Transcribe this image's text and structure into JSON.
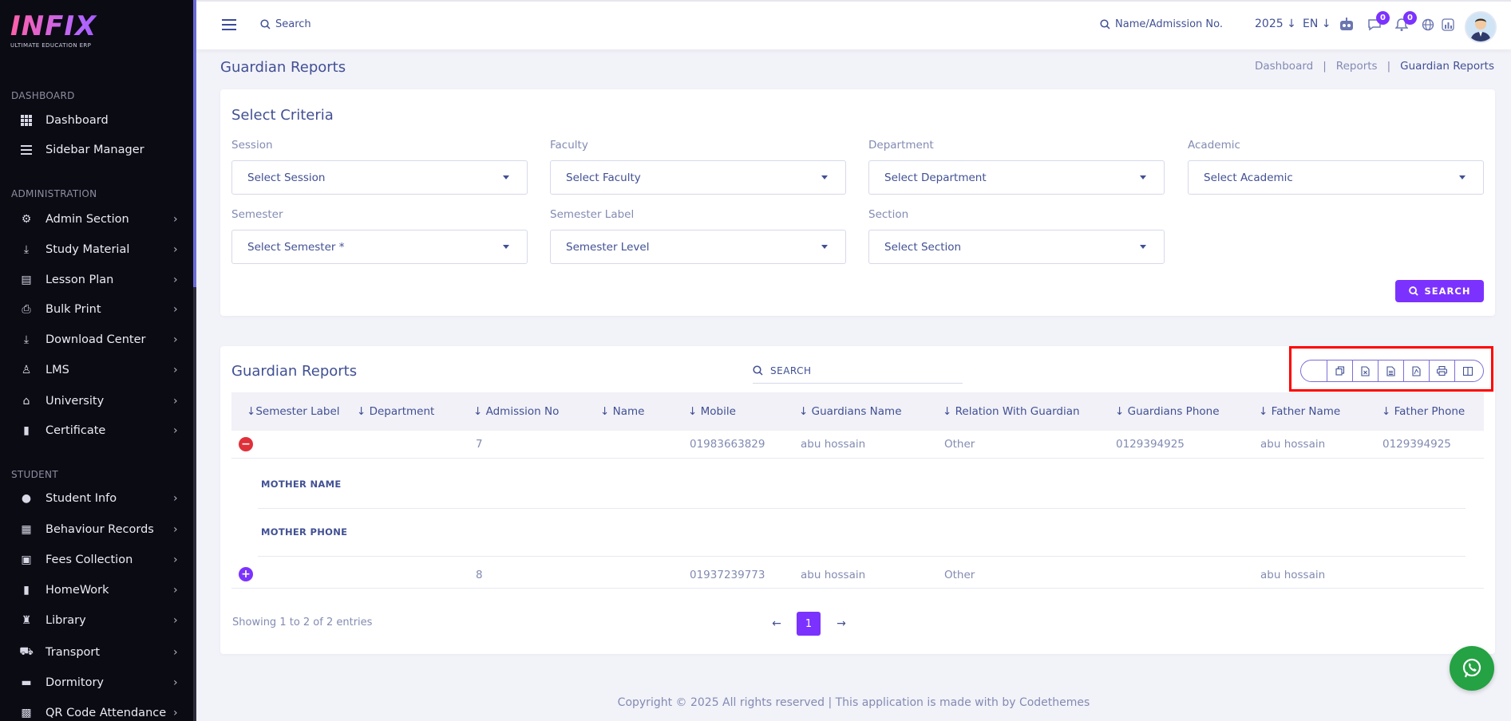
{
  "brand": {
    "logo_text": "INFIX",
    "tagline": "ULTIMATE EDUCATION ERP"
  },
  "sidebar": {
    "sections": [
      {
        "label": "DASHBOARD"
      },
      {
        "label": "ADMINISTRATION"
      },
      {
        "label": "STUDENT"
      }
    ],
    "items": [
      {
        "label": "Dashboard",
        "icon": "grid-icon",
        "chevron": false
      },
      {
        "label": "Sidebar Manager",
        "icon": "menu-icon",
        "chevron": false
      },
      {
        "label": "Admin Section",
        "icon": "admin-icon",
        "chevron": true
      },
      {
        "label": "Study Material",
        "icon": "download-icon",
        "chevron": true
      },
      {
        "label": "Lesson Plan",
        "icon": "lesson-icon",
        "chevron": true
      },
      {
        "label": "Bulk Print",
        "icon": "printer-icon",
        "chevron": true
      },
      {
        "label": "Download Center",
        "icon": "download-icon",
        "chevron": true
      },
      {
        "label": "LMS",
        "icon": "lms-icon",
        "chevron": true
      },
      {
        "label": "University",
        "icon": "university-icon",
        "chevron": true
      },
      {
        "label": "Certificate",
        "icon": "book-icon",
        "chevron": true
      },
      {
        "label": "Student Info",
        "icon": "user-icon",
        "chevron": true
      },
      {
        "label": "Behaviour Records",
        "icon": "records-icon",
        "chevron": true
      },
      {
        "label": "Fees Collection",
        "icon": "fees-icon",
        "chevron": true
      },
      {
        "label": "HomeWork",
        "icon": "book-icon",
        "chevron": true
      },
      {
        "label": "Library",
        "icon": "library-icon",
        "chevron": true
      },
      {
        "label": "Transport",
        "icon": "bus-icon",
        "chevron": true
      },
      {
        "label": "Dormitory",
        "icon": "bed-icon",
        "chevron": true
      },
      {
        "label": "QR Code Attendance",
        "icon": "qr-icon",
        "chevron": true
      }
    ]
  },
  "topbar": {
    "search_label": "Search",
    "admission_search_label": "Name/Admission No.",
    "year": "2025",
    "language": "EN",
    "messages_count": "0",
    "notifications_count": "0"
  },
  "page": {
    "title": "Guardian Reports",
    "breadcrumbs": [
      "Dashboard",
      "Reports",
      "Guardian Reports"
    ]
  },
  "criteria": {
    "title": "Select Criteria",
    "fields": [
      {
        "label": "Session",
        "value": "Select Session"
      },
      {
        "label": "Faculty",
        "value": "Select Faculty"
      },
      {
        "label": "Department",
        "value": "Select Department"
      },
      {
        "label": "Academic",
        "value": "Select Academic"
      },
      {
        "label": "Semester",
        "value": "Select Semester *"
      },
      {
        "label": "Semester Label",
        "value": "Semester Level"
      },
      {
        "label": "Section",
        "value": "Select Section"
      }
    ],
    "search_button": "SEARCH"
  },
  "report": {
    "title": "Guardian Reports",
    "search_placeholder": "SEARCH",
    "columns": [
      "Semester Label",
      "Department",
      "Admission No",
      "Name",
      "Mobile",
      "Guardians Name",
      "Relation With Guardian",
      "Guardians Phone",
      "Father Name",
      "Father Phone"
    ],
    "rows": [
      {
        "semester_label": "",
        "department": "",
        "admission_no": "7",
        "name": "",
        "mobile": "01983663829",
        "guardians_name": "abu hossain",
        "relation": "Other",
        "guardians_phone": "0129394925",
        "father_name": "abu hossain",
        "father_phone": "0129394925",
        "expanded": true
      },
      {
        "semester_label": "",
        "department": "",
        "admission_no": "8",
        "name": "",
        "mobile": "01937239773",
        "guardians_name": "abu hossain",
        "relation": "Other",
        "guardians_phone": "",
        "father_name": "abu hossain",
        "father_phone": "",
        "expanded": false
      }
    ],
    "child_labels": [
      "MOTHER NAME",
      "MOTHER PHONE"
    ],
    "info": "Showing 1 to 2 of 2 entries",
    "current_page": "1"
  },
  "footer": {
    "text": "Copyright © 2025 All rights reserved | This application is made with by Codethemes"
  },
  "colors": {
    "accent": "#7c32ff",
    "text": "#415094",
    "muted": "#828bb2",
    "sidebar_bg": "#0b0b14",
    "highlight": "#ff0000"
  }
}
